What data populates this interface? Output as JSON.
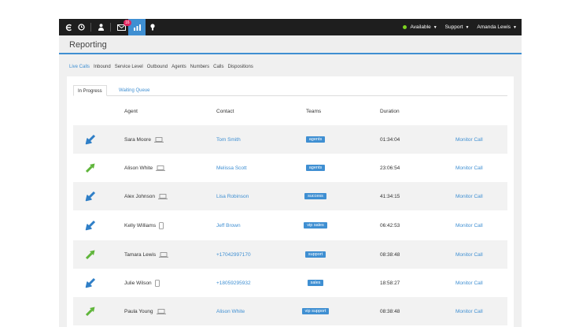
{
  "topbar": {
    "badge_count": "16",
    "status_label": "Available",
    "support_label": "Support",
    "user_name": "Amanda Lewis",
    "status_color": "#7ed321"
  },
  "page": {
    "title": "Reporting"
  },
  "nav": {
    "tabs": [
      "Live Calls",
      "Inbound",
      "Service Level",
      "Outbound",
      "Agents",
      "Numbers",
      "Calls",
      "Dispositions"
    ],
    "active": "Live Calls"
  },
  "subtabs": {
    "in_progress": "In Progress",
    "waiting_queue": "Waiting Queue"
  },
  "table": {
    "headers": {
      "agent": "Agent",
      "contact": "Contact",
      "teams": "Teams",
      "duration": "Duration"
    },
    "monitor_label": "Monitor Call",
    "rows": [
      {
        "direction": "inbound",
        "agent": "Sara Moore",
        "device": "laptop-icon",
        "contact": "Tom Smith",
        "team": "agents",
        "duration": "01:34:04"
      },
      {
        "direction": "outbound",
        "agent": "Alison White",
        "device": "laptop-icon",
        "contact": "Melissa Scott",
        "team": "agents",
        "duration": "23:06:54"
      },
      {
        "direction": "inbound",
        "agent": "Alex Johnson",
        "device": "laptop-icon",
        "contact": "Lisa Robinson",
        "team": "success",
        "duration": "41:34:15"
      },
      {
        "direction": "inbound",
        "agent": "Kelly Williams",
        "device": "phone-icon",
        "contact": "Jeff Brown",
        "team": "vip sales",
        "duration": "06:42:53"
      },
      {
        "direction": "outbound",
        "agent": "Tamara Lewis",
        "device": "laptop-icon",
        "contact": "+17042997170",
        "team": "support",
        "duration": "08:38:48"
      },
      {
        "direction": "inbound",
        "agent": "Julie Wilson",
        "device": "phone-icon",
        "contact": "+18059295932",
        "team": "sales",
        "duration": "18:58:27"
      },
      {
        "direction": "outbound",
        "agent": "Paula Young",
        "device": "laptop-icon",
        "contact": "Alison White",
        "team": "vip support",
        "duration": "08:38:48"
      }
    ]
  },
  "colors": {
    "accent": "#3f8fd2",
    "inbound": "#2f7fc7",
    "outbound": "#5fb53a",
    "topbar": "#1e1e1e"
  }
}
